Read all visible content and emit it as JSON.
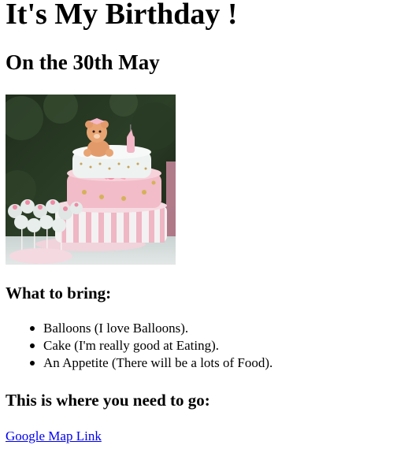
{
  "header": {
    "title": "It's My Birthday !",
    "date": "On the 30th May"
  },
  "image": {
    "icon": "birthday-cake-image"
  },
  "bring_section": {
    "heading": "What to bring:",
    "items": [
      "Balloons (I love Balloons).",
      "Cake (I'm really good at Eating).",
      "An Appetite (There will be a lots of Food)."
    ]
  },
  "location_section": {
    "heading": "This is where you need to go:",
    "link_text": "Google Map Link"
  },
  "colors": {
    "link": "#0000ee",
    "text": "#000000",
    "background": "#ffffff",
    "cake_pink": "#f2bcc8",
    "cake_white": "#eef2f1"
  }
}
